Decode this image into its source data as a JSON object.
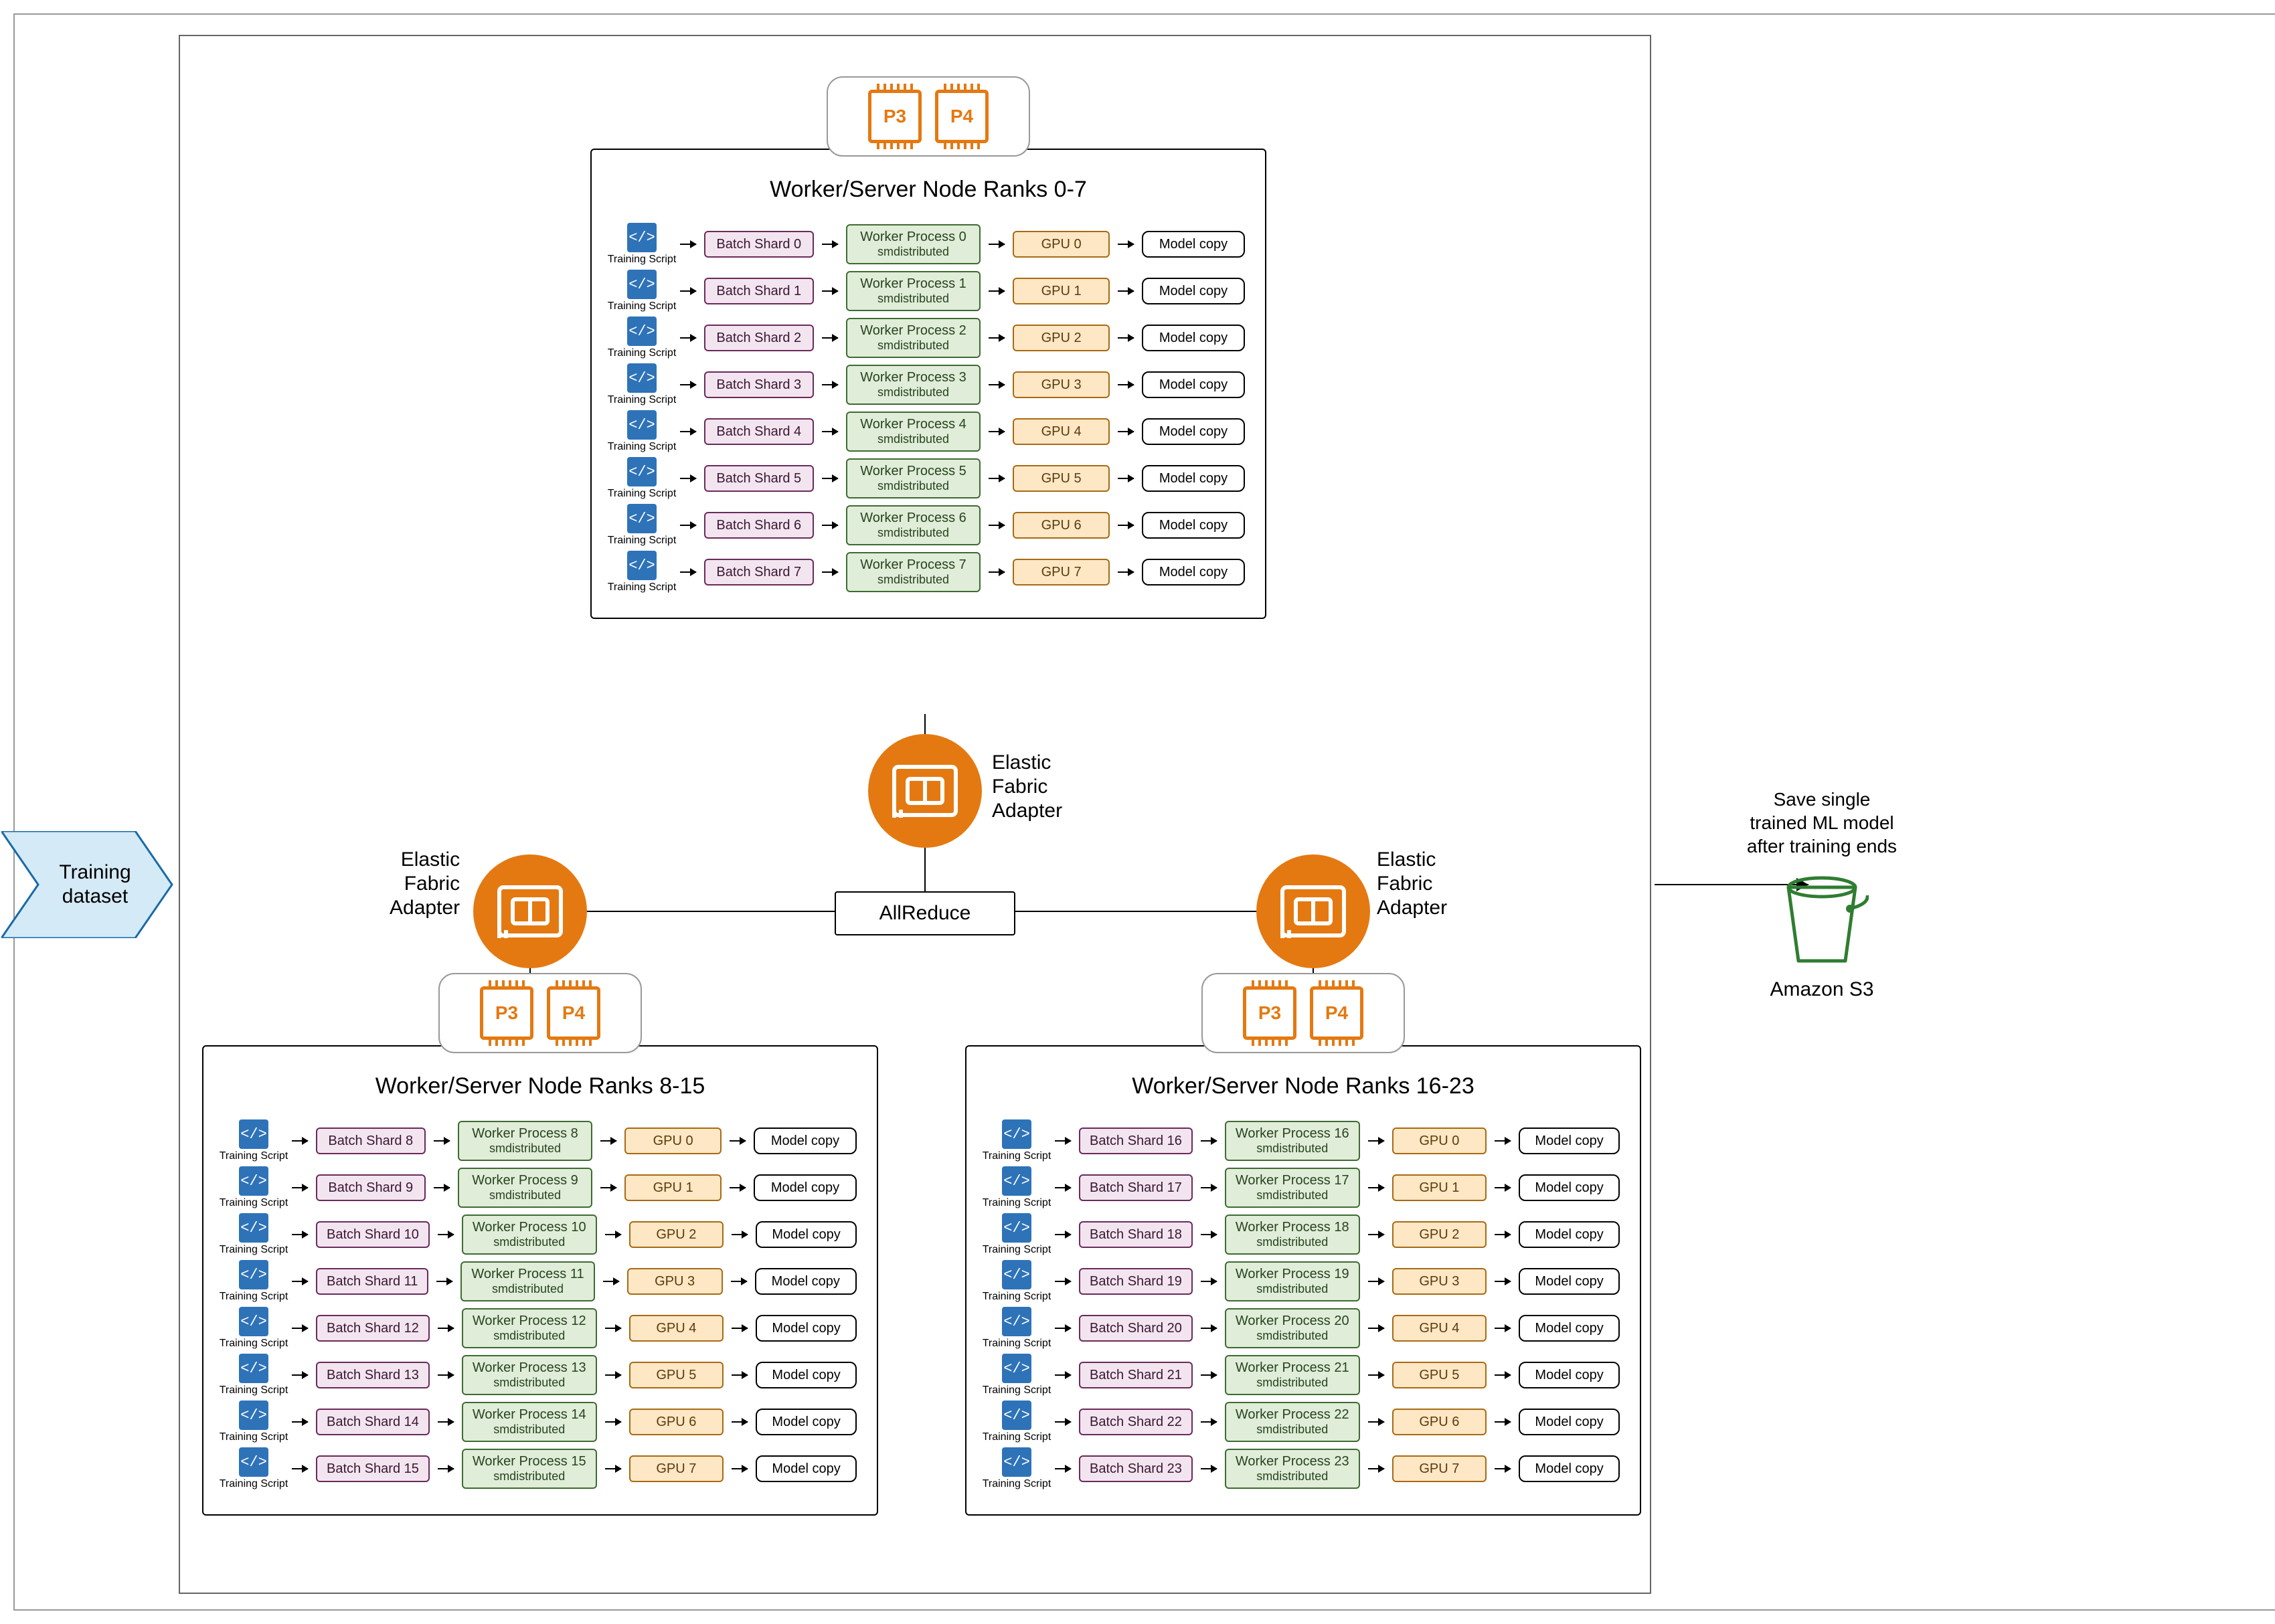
{
  "dataset_label": "Training\ndataset",
  "allreduce_label": "AllReduce",
  "save_text": "Save single\ntrained ML model\nafter training ends",
  "s3_label": "Amazon S3",
  "efa_label": "Elastic\nFabric\nAdapter",
  "chip_labels": [
    "P3",
    "P4"
  ],
  "script_label": "Training Script",
  "worker_sub": "smdistributed",
  "nodes": [
    {
      "title": "Worker/Server Node Ranks 0-7",
      "rows": [
        {
          "shard": "Batch Shard 0",
          "worker": "Worker Process 0",
          "gpu": "GPU 0",
          "model": "Model copy"
        },
        {
          "shard": "Batch Shard 1",
          "worker": "Worker Process 1",
          "gpu": "GPU 1",
          "model": "Model copy"
        },
        {
          "shard": "Batch Shard 2",
          "worker": "Worker Process 2",
          "gpu": "GPU 2",
          "model": "Model copy"
        },
        {
          "shard": "Batch Shard 3",
          "worker": "Worker Process 3",
          "gpu": "GPU 3",
          "model": "Model copy"
        },
        {
          "shard": "Batch Shard 4",
          "worker": "Worker Process 4",
          "gpu": "GPU 4",
          "model": "Model copy"
        },
        {
          "shard": "Batch Shard 5",
          "worker": "Worker Process 5",
          "gpu": "GPU 5",
          "model": "Model copy"
        },
        {
          "shard": "Batch Shard 6",
          "worker": "Worker Process 6",
          "gpu": "GPU 6",
          "model": "Model copy"
        },
        {
          "shard": "Batch Shard 7",
          "worker": "Worker Process 7",
          "gpu": "GPU 7",
          "model": "Model copy"
        }
      ]
    },
    {
      "title": "Worker/Server Node Ranks 8-15",
      "rows": [
        {
          "shard": "Batch Shard 8",
          "worker": "Worker Process 8",
          "gpu": "GPU 0",
          "model": "Model copy"
        },
        {
          "shard": "Batch Shard 9",
          "worker": "Worker Process 9",
          "gpu": "GPU 1",
          "model": "Model copy"
        },
        {
          "shard": "Batch Shard 10",
          "worker": "Worker Process 10",
          "gpu": "GPU 2",
          "model": "Model copy"
        },
        {
          "shard": "Batch Shard 11",
          "worker": "Worker Process 11",
          "gpu": "GPU 3",
          "model": "Model copy"
        },
        {
          "shard": "Batch Shard 12",
          "worker": "Worker Process 12",
          "gpu": "GPU 4",
          "model": "Model copy"
        },
        {
          "shard": "Batch Shard 13",
          "worker": "Worker Process 13",
          "gpu": "GPU 5",
          "model": "Model copy"
        },
        {
          "shard": "Batch Shard 14",
          "worker": "Worker Process 14",
          "gpu": "GPU 6",
          "model": "Model copy"
        },
        {
          "shard": "Batch Shard 15",
          "worker": "Worker Process 15",
          "gpu": "GPU 7",
          "model": "Model copy"
        }
      ]
    },
    {
      "title": "Worker/Server Node Ranks 16-23",
      "rows": [
        {
          "shard": "Batch Shard 16",
          "worker": "Worker Process 16",
          "gpu": "GPU 0",
          "model": "Model copy"
        },
        {
          "shard": "Batch Shard 17",
          "worker": "Worker Process 17",
          "gpu": "GPU 1",
          "model": "Model copy"
        },
        {
          "shard": "Batch Shard 18",
          "worker": "Worker Process 18",
          "gpu": "GPU 2",
          "model": "Model copy"
        },
        {
          "shard": "Batch Shard 19",
          "worker": "Worker Process 19",
          "gpu": "GPU 3",
          "model": "Model copy"
        },
        {
          "shard": "Batch Shard 20",
          "worker": "Worker Process 20",
          "gpu": "GPU 4",
          "model": "Model copy"
        },
        {
          "shard": "Batch Shard 21",
          "worker": "Worker Process 21",
          "gpu": "GPU 5",
          "model": "Model copy"
        },
        {
          "shard": "Batch Shard 22",
          "worker": "Worker Process 22",
          "gpu": "GPU 6",
          "model": "Model copy"
        },
        {
          "shard": "Batch Shard 23",
          "worker": "Worker Process 23",
          "gpu": "GPU 7",
          "model": "Model copy"
        }
      ]
    }
  ]
}
